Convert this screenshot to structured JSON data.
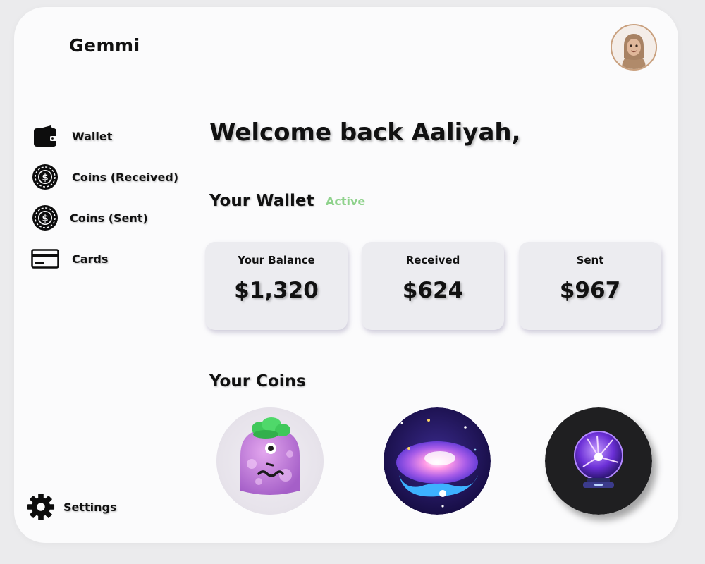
{
  "app": {
    "name": "Gemmi"
  },
  "user": {
    "avatar_icon": "user-avatar-icon"
  },
  "sidebar": {
    "items": [
      {
        "label": "Wallet",
        "icon": "wallet-icon"
      },
      {
        "label": "Coins (Received)",
        "icon": "coin-icon"
      },
      {
        "label": "Coins (Sent)",
        "icon": "coin-icon"
      },
      {
        "label": "Cards",
        "icon": "card-icon"
      }
    ],
    "settings_label": "Settings"
  },
  "main": {
    "greeting": "Welcome back Aaliyah,",
    "wallet": {
      "title": "Your Wallet",
      "status": "Active",
      "status_color": "#8fd28c",
      "cards": [
        {
          "label": "Your Balance",
          "value": "$1,320"
        },
        {
          "label": "Received",
          "value": "$624"
        },
        {
          "label": "Sent",
          "value": "$967"
        }
      ]
    },
    "coins": {
      "title": "Your Coins",
      "items": [
        {
          "icon": "purple-monster-coin-icon"
        },
        {
          "icon": "galaxy-coin-icon"
        },
        {
          "icon": "plasma-ball-coin-icon"
        }
      ]
    }
  }
}
